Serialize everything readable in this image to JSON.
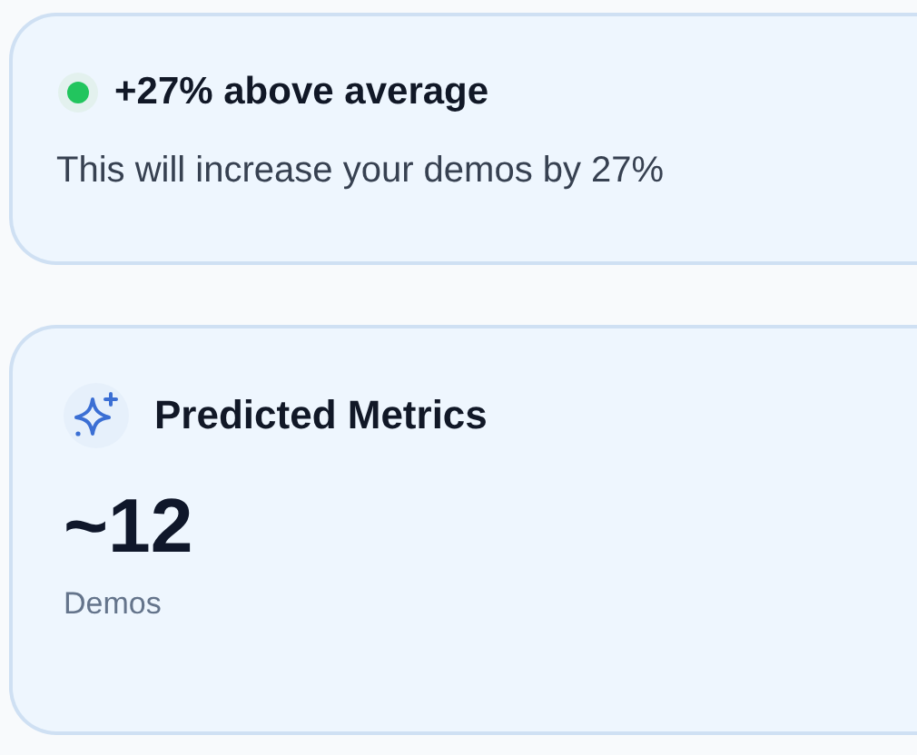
{
  "highlight": {
    "color": "#22c55e",
    "title": "+27% above average",
    "description": "This will increase your demos by 27%"
  },
  "metrics": {
    "title": "Predicted Metrics",
    "value": "~12",
    "label": "Demos"
  }
}
